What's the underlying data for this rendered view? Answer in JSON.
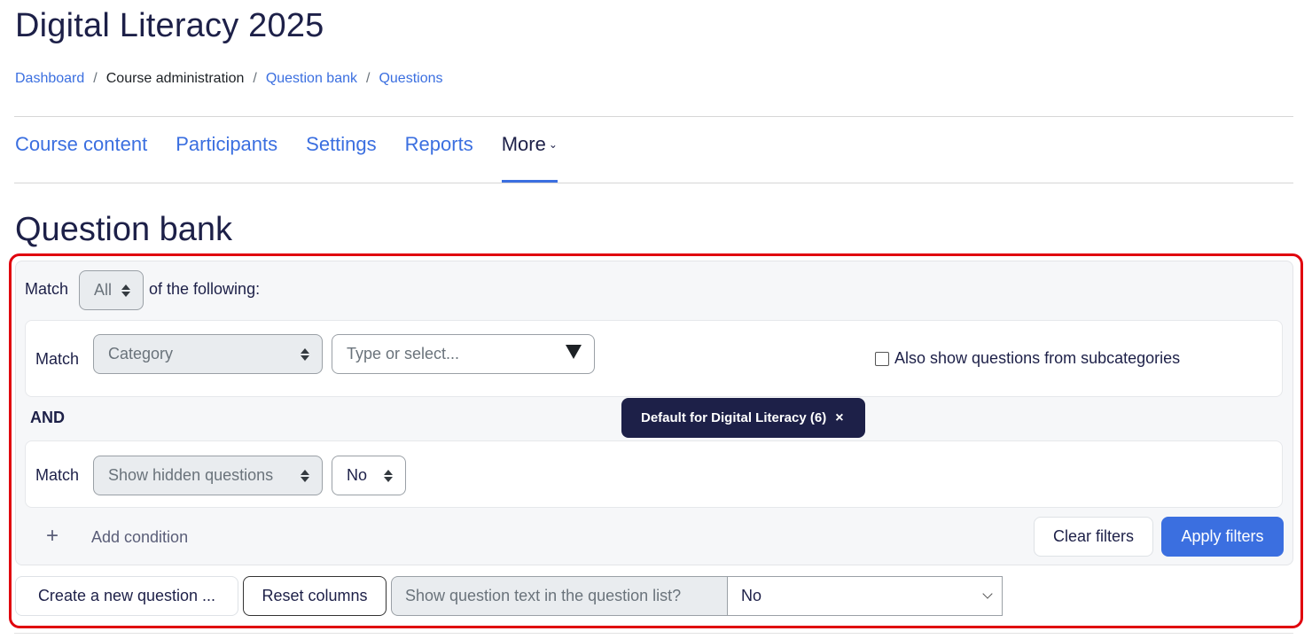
{
  "header": {
    "title": "Digital Literacy 2025"
  },
  "breadcrumb": {
    "items": [
      {
        "label": "Dashboard",
        "link": true
      },
      {
        "label": "Course administration",
        "link": false
      },
      {
        "label": "Question bank",
        "link": true
      },
      {
        "label": "Questions",
        "link": true
      }
    ],
    "separator": "/"
  },
  "nav": {
    "tabs": [
      {
        "label": "Course content",
        "active": false
      },
      {
        "label": "Participants",
        "active": false
      },
      {
        "label": "Settings",
        "active": false
      },
      {
        "label": "Reports",
        "active": false
      },
      {
        "label": "More",
        "active": true,
        "icon": "chevron-down-icon"
      }
    ]
  },
  "section": {
    "title": "Question bank"
  },
  "filters": {
    "match_label": "Match",
    "match_value": "All",
    "match_suffix": "of the following:",
    "conditions": [
      {
        "match_label": "Match",
        "field": "Category",
        "search_placeholder": "Type or select...",
        "selected_chip": "Default for Digital Literacy (6)",
        "chip_remove": "×",
        "checkbox_label": "Also show questions from subcategories",
        "checkbox_checked": false
      },
      {
        "match_label": "Match",
        "field": "Show hidden questions",
        "value": "No"
      }
    ],
    "joiner": "AND",
    "add_condition_icon": "+",
    "add_condition_label": "Add condition",
    "clear_label": "Clear filters",
    "apply_label": "Apply filters"
  },
  "actions": {
    "create_question_label": "Create a new question ...",
    "reset_columns_label": "Reset columns",
    "show_text_label": "Show question text in the question list?",
    "show_text_value": "No"
  },
  "colors": {
    "accent": "#3b6fe0",
    "chip": "#1d2048",
    "highlight": "#e0000d"
  }
}
